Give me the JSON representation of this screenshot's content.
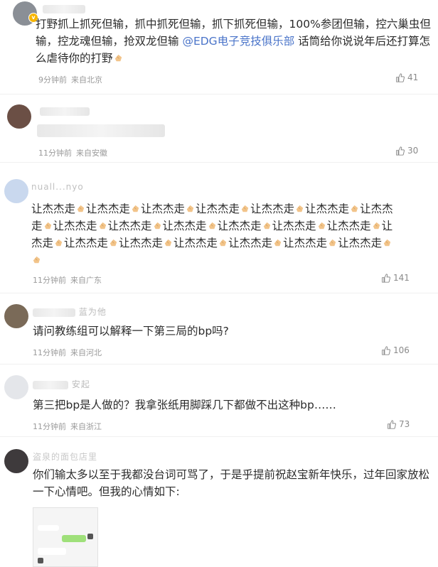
{
  "comments": [
    {
      "text_part1": "打野抓上抓死但输，抓中抓死但输，抓下抓死但输，100%参团但输，控六巢虫但输，控龙魂但输，抢双龙但输",
      "mention": "@EDG电子竞技俱乐部",
      "text_part2": "话筒给你说说年后还打算怎么虐待你的打野",
      "time": "9分钟前",
      "source": "来自北京",
      "likes": "41"
    },
    {
      "time": "11分钟前",
      "source": "来自安徽",
      "likes": "30"
    },
    {
      "name": "nuall...nyo",
      "chant": "让杰杰走",
      "chant_lines": [
        "让杰杰走",
        "走",
        "杰走"
      ],
      "time": "11分钟前",
      "source": "来自广东",
      "likes": "141"
    },
    {
      "name_tail": "蓝为他",
      "text": "请问教练组可以解释一下第三局的bp吗?",
      "time": "11分钟前",
      "source": "来自河北",
      "likes": "106"
    },
    {
      "name_tail": "安起",
      "text": "第三把bp是人做的？我拿张纸用脚踩几下都做不出这种bp……",
      "time": "11分钟前",
      "source": "来自浙江",
      "likes": "73"
    },
    {
      "name": "盗泉的面包店里",
      "text": "你们输太多以至于我都没台词可骂了，于是乎提前祝赵宝新年快乐，过年回家放松一下心情吧。但我的心情如下:"
    }
  ],
  "colors": {
    "mention": "#4a74c9",
    "meta": "#9a9a9a",
    "text": "#2b2b2b"
  },
  "icons": [
    "thumb-up-icon",
    "clapping-hands-emoji",
    "verified-badge-icon"
  ]
}
